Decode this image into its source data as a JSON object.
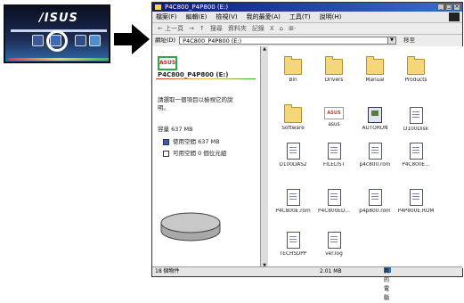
{
  "thumbnail": {
    "logo_text": "/ISUS"
  },
  "window": {
    "title": "P4C800_P4P800 (E:)",
    "controls": [
      "_",
      "□",
      "×"
    ],
    "menu": [
      "檔案(F)",
      "編輯(E)",
      "檢視(V)",
      "我的最愛(A)",
      "工具(T)",
      "說明(H)"
    ],
    "toolbar": [
      "← 上一頁",
      "→",
      "↑",
      "搜尋",
      "資料夾",
      "記錄",
      "X",
      "⌂",
      "⊞·"
    ],
    "address_label": "網址(D)",
    "address_value": "P4C800_P4P800 (E:)",
    "go_label": "移至"
  },
  "left_pane": {
    "drive_icon_text": "ASUS",
    "drive_title": "P4C800_P4P800 (E:)",
    "hint_line1": "請選取一個項目以檢視它的說",
    "hint_line2": "明。",
    "capacity": "容量 637 MB",
    "used": "使用空間 637 MB",
    "free": "可用空間 0 個位元組"
  },
  "files": [
    {
      "name": "Bin",
      "type": "folder"
    },
    {
      "name": "Drivers",
      "type": "folder"
    },
    {
      "name": "Manual",
      "type": "folder"
    },
    {
      "name": "Products",
      "type": "folder"
    },
    {
      "name": "Software",
      "type": "folder"
    },
    {
      "name": "asus",
      "type": "asus"
    },
    {
      "name": "AUTORUN",
      "type": "exe"
    },
    {
      "name": "D100Disk",
      "type": "doc"
    },
    {
      "name": "D100DAS2",
      "type": "doc"
    },
    {
      "name": "FILELIST",
      "type": "doc"
    },
    {
      "name": "p4c800.rom",
      "type": "doc"
    },
    {
      "name": "P4C800E...",
      "type": "doc"
    },
    {
      "name": "P4C800E.rom",
      "type": "doc"
    },
    {
      "name": "P4C800ED...",
      "type": "doc"
    },
    {
      "name": "p4p800.rom",
      "type": "doc"
    },
    {
      "name": "P4P800E.ROM",
      "type": "doc"
    },
    {
      "name": "TECHSUPP",
      "type": "doc"
    },
    {
      "name": "ver.log",
      "type": "doc"
    }
  ],
  "status": {
    "count": "18 個物件",
    "size": "2.01 MB",
    "location": "我的電腦"
  }
}
